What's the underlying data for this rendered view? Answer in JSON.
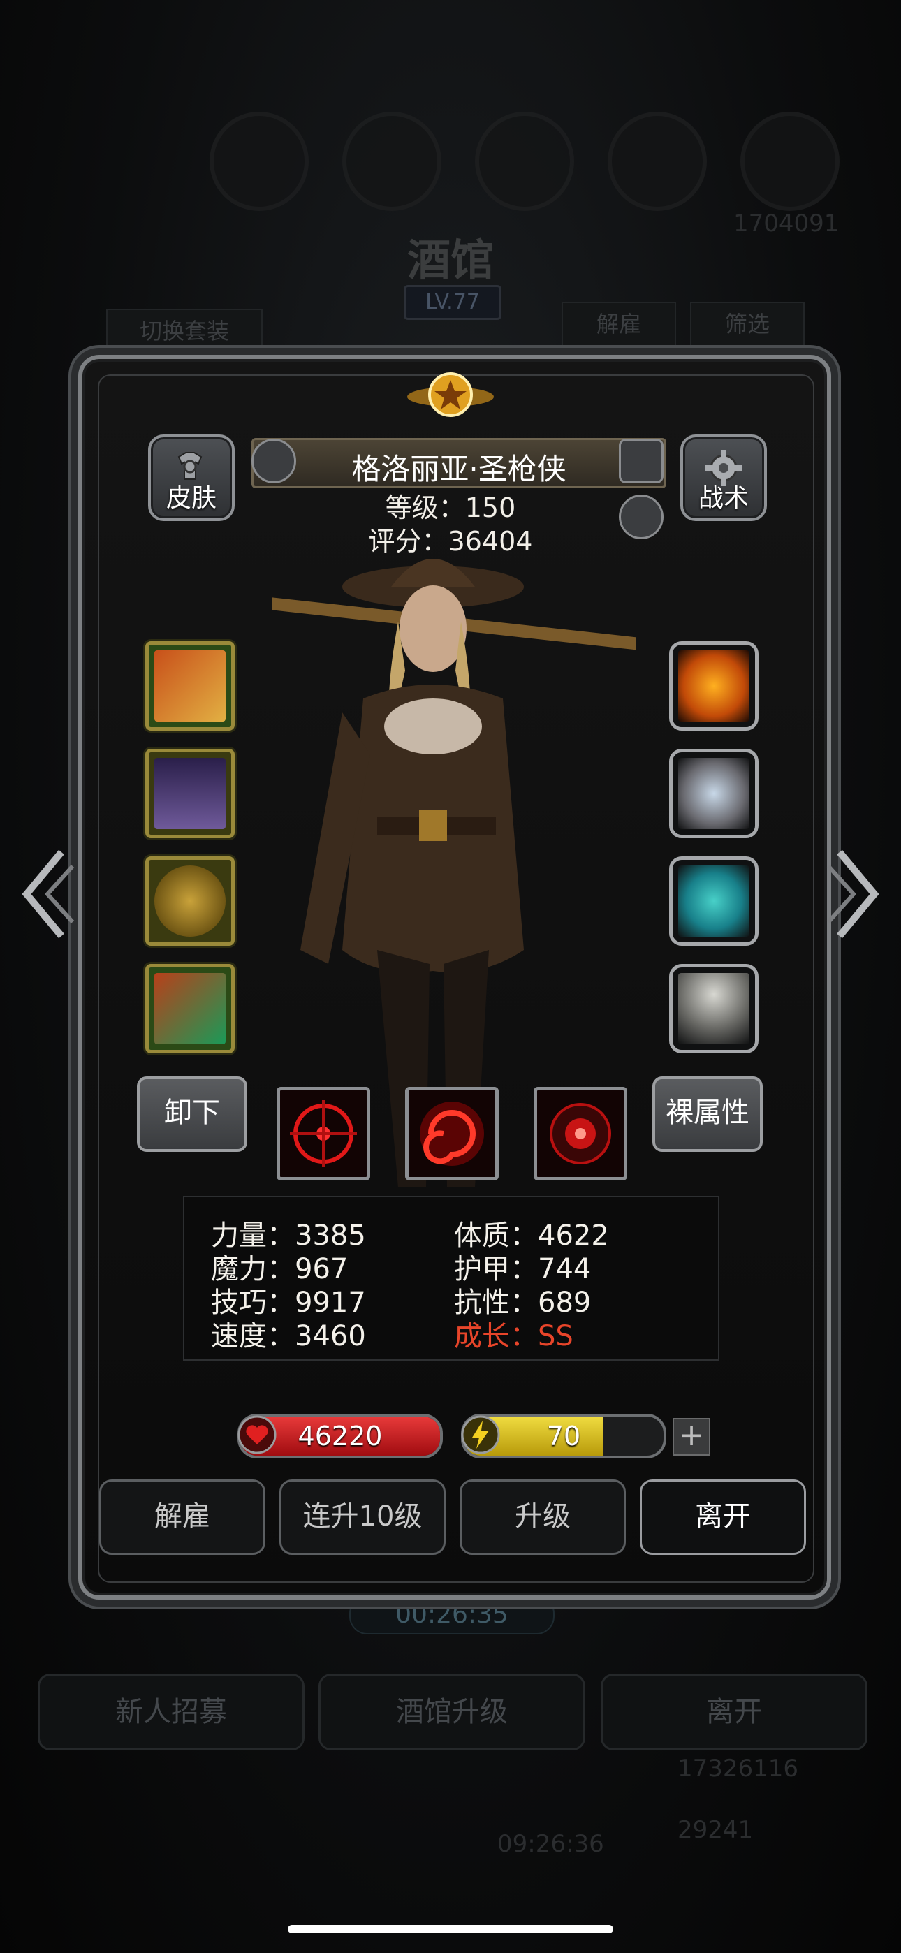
{
  "background": {
    "tavern_title": "酒馆",
    "tavern_level": "LV.77",
    "switch_set_label": "切换套装",
    "dismiss_label": "解雇",
    "filter_label": "筛选",
    "timer_label": "00:26:35",
    "new_recruit_label": "新人招募",
    "tavern_upgrade_label": "酒馆升级",
    "leave_label": "离开",
    "gold_amount": "17326116",
    "gem_amount": "29241",
    "clock": "09:26:36",
    "top_number": "1704091"
  },
  "hero": {
    "name": "格洛丽亚·圣枪侠",
    "level_label": "等级：150",
    "score_label": "评分：36404"
  },
  "header_buttons": {
    "skin_label": "皮肤",
    "tactics_label": "战术"
  },
  "actions": {
    "unequip_label": "卸下",
    "base_attr_label": "裸属性"
  },
  "stats": {
    "strength": "力量：3385",
    "magic": "魔力：967",
    "skill": "技巧：9917",
    "speed": "速度：3460",
    "constitution": "体质：4622",
    "armor": "护甲：744",
    "resistance": "抗性：689",
    "growth": "成长：SS"
  },
  "bars": {
    "hp_value": "46220",
    "energy_value": "70",
    "energy_fraction": 0.7,
    "plus": "+"
  },
  "footer": {
    "dismiss_label": "解雇",
    "levelup10_label": "连升10级",
    "levelup_label": "升级",
    "leave_label": "离开"
  },
  "colors": {
    "growth_red": "#e8452a",
    "hp_red": "#c8161c",
    "energy_yellow": "#d9c21a"
  }
}
